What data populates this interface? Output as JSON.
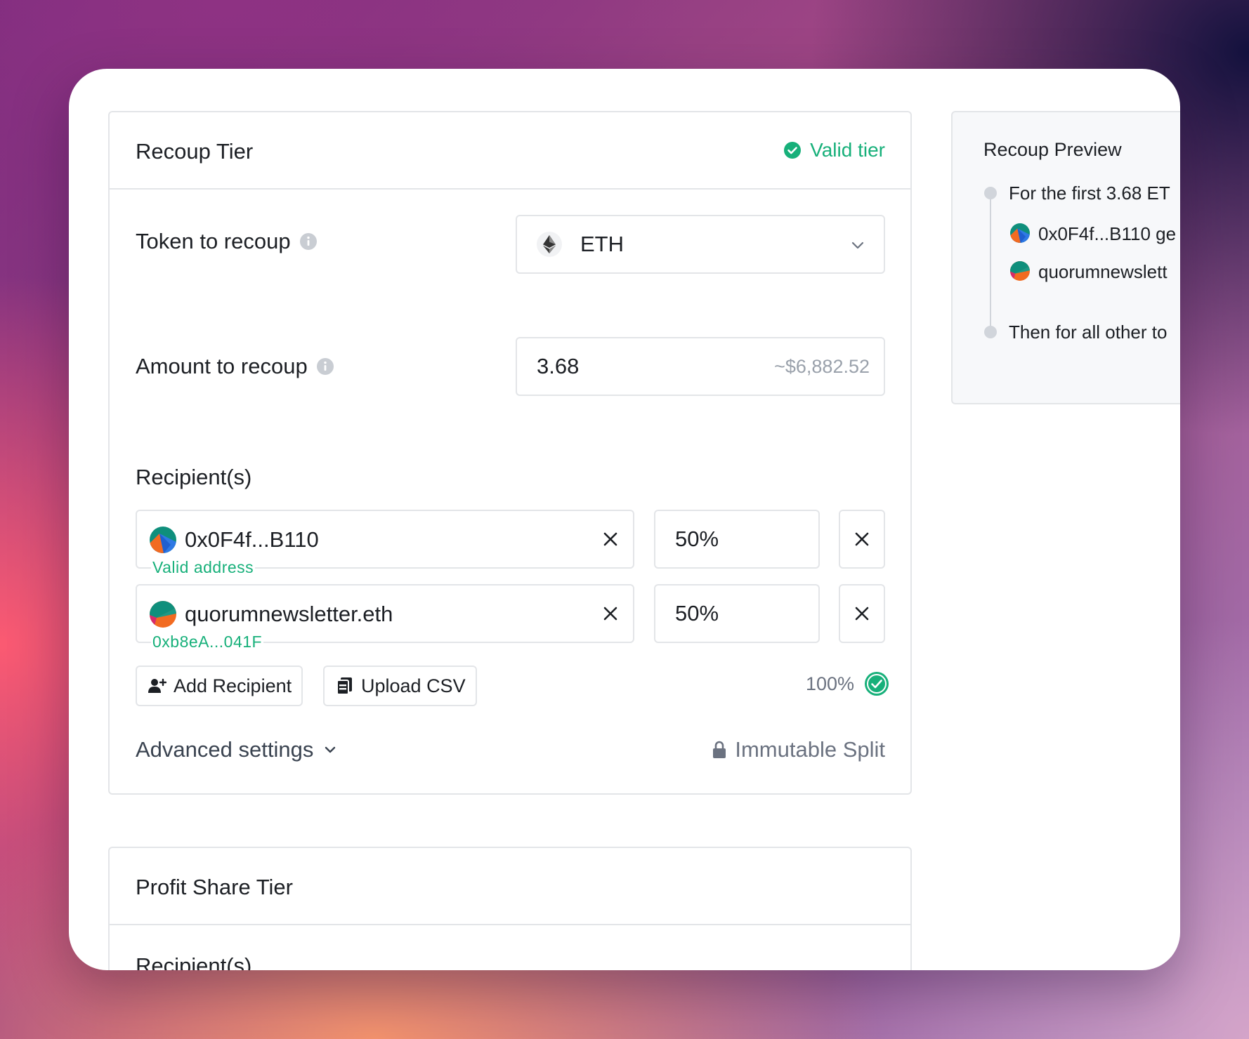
{
  "recoup_tier": {
    "title": "Recoup Tier",
    "status": "Valid tier",
    "token_label": "Token to recoup",
    "token_value": "ETH",
    "amount_label": "Amount to recoup",
    "amount_value": "3.68",
    "amount_usd": "~$6,882.52",
    "recipients_label": "Recipient(s)",
    "recipients": [
      {
        "address": "0x0F4f...B110",
        "sub": "Valid address",
        "percent": "50%"
      },
      {
        "address": "quorumnewsletter.eth",
        "sub": "0xb8eA...041F",
        "percent": "50%"
      }
    ],
    "add_recipient_label": "Add Recipient",
    "upload_csv_label": "Upload CSV",
    "total_percent": "100%",
    "advanced_label": "Advanced settings",
    "immutable_label": "Immutable Split"
  },
  "profit_share_tier": {
    "title": "Profit Share Tier",
    "recipients_label": "Recipient(s)"
  },
  "preview": {
    "title": "Recoup Preview",
    "first_line": "For the first 3.68 ET",
    "recipients": [
      "0x0F4f...B110 ge",
      "quorumnewslett"
    ],
    "then_line": "Then for all other to"
  },
  "colors": {
    "accent_green": "#17b07a",
    "border": "#e3e5e8",
    "text": "#1c1f24"
  }
}
